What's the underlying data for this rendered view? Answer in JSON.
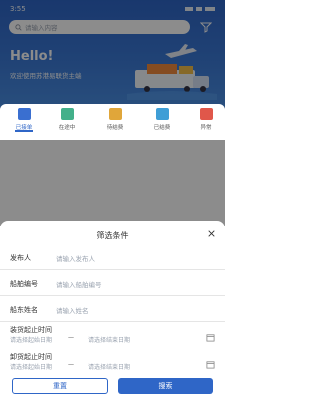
{
  "status_bar": {
    "time": "3:55"
  },
  "search": {
    "placeholder": "请输入内容"
  },
  "hero": {
    "greeting": "Hello!",
    "welcome": "欢迎使用苏港易联货主端"
  },
  "nav": {
    "items": [
      {
        "label": "已接单"
      },
      {
        "label": "在途中"
      },
      {
        "label": "待结费"
      },
      {
        "label": "已结费"
      },
      {
        "label": "异常"
      }
    ]
  },
  "filter_sheet": {
    "title": "筛选条件",
    "fields": [
      {
        "label": "发布人",
        "placeholder": "请输入发布人"
      },
      {
        "label": "船舶编号",
        "placeholder": "请输入船舶编号"
      },
      {
        "label": "船东姓名",
        "placeholder": "请输入姓名"
      }
    ],
    "loading_time": {
      "label": "装货起止时间",
      "start_placeholder": "请选择起始日期",
      "separator": "—",
      "end_placeholder": "请选择结束日期"
    },
    "unloading_time": {
      "label": "卸货起止时间",
      "start_placeholder": "请选择起始日期",
      "separator": "—",
      "end_placeholder": "请选择结束日期"
    },
    "reset_label": "重置",
    "search_label": "搜索"
  },
  "colors": {
    "primary": "#2f66c7"
  }
}
